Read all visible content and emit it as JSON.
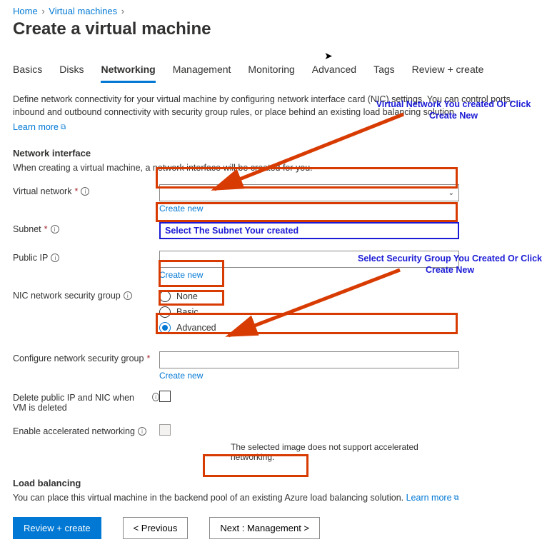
{
  "breadcrumb": {
    "home": "Home",
    "vms": "Virtual machines"
  },
  "page_title": "Create a virtual machine",
  "tabs": {
    "basics": "Basics",
    "disks": "Disks",
    "networking": "Networking",
    "management": "Management",
    "monitoring": "Monitoring",
    "advanced": "Advanced",
    "tags": "Tags",
    "review": "Review + create"
  },
  "intro": "Define network connectivity for your virtual machine by configuring network interface card (NIC) settings. You can control ports, inbound and outbound connectivity with security group rules, or place behind an existing load balancing solution.",
  "learn_more": "Learn more",
  "sections": {
    "nic": {
      "title": "Network interface",
      "subtitle": "When creating a virtual machine, a network interface will be created for you."
    },
    "lb": {
      "title": "Load balancing",
      "subtitle": "You can place this virtual machine in the backend pool of an existing Azure load balancing solution."
    }
  },
  "labels": {
    "vnet": "Virtual network",
    "subnet": "Subnet",
    "public_ip": "Public IP",
    "nsg": "NIC network security group",
    "config_nsg": "Configure network security group",
    "delete_pip": "Delete public IP and NIC when VM is deleted",
    "accel": "Enable accelerated networking"
  },
  "links": {
    "create_new": "Create new"
  },
  "radios": {
    "none": "None",
    "basic": "Basic",
    "advanced": "Advanced"
  },
  "subnet_placeholder": "Select The Subnet Your created",
  "accel_note": "The selected image does not support accelerated networking.",
  "footer": {
    "review": "Review + create",
    "previous": "< Previous",
    "next": "Next : Management >"
  },
  "annotations": {
    "vnet": "Virtual Network You created Or Click Create New",
    "nsg": "Select Security Group You Created Or Click Create New"
  }
}
